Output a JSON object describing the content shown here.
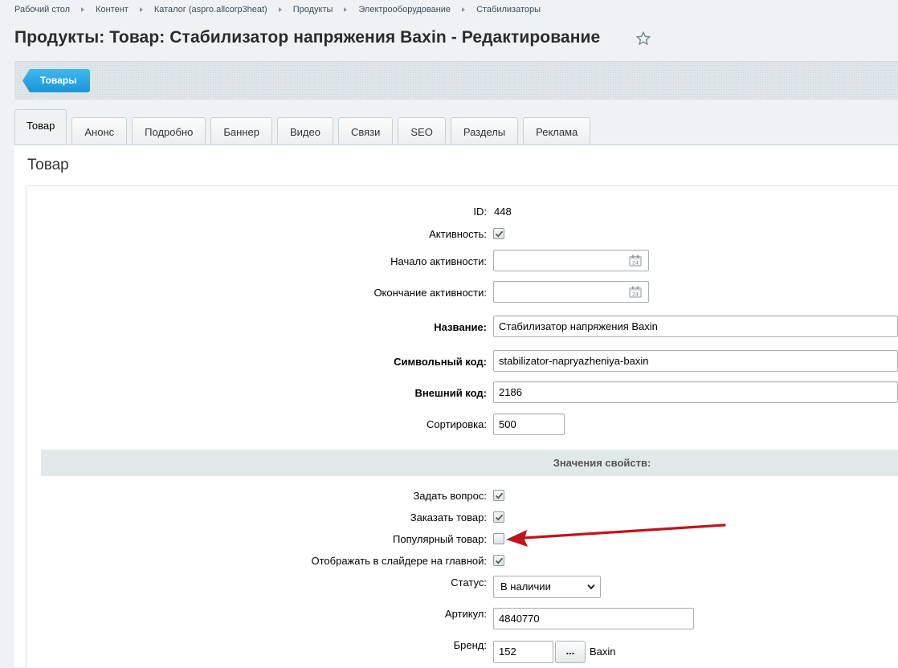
{
  "breadcrumb": [
    "Рабочий стол",
    "Контент",
    "Каталог (aspro.allcorp3heat)",
    "Продукты",
    "Электрооборудование",
    "Стабилизаторы"
  ],
  "title": "Продукты: Товар: Стабилизатор напряжения Baxin - Редактирование",
  "toolbar": {
    "back_label": "Товары"
  },
  "tabs": [
    "Товар",
    "Анонс",
    "Подробно",
    "Баннер",
    "Видео",
    "Связи",
    "SEO",
    "Разделы",
    "Реклама"
  ],
  "active_tab": "Товар",
  "panel_heading": "Товар",
  "form": {
    "id_label": "ID:",
    "id_value": "448",
    "active_label": "Активность:",
    "active_checked": true,
    "start_label": "Начало активности:",
    "end_label": "Окончание активности:",
    "name_label": "Название:",
    "name_value": "Стабилизатор напряжения Baxin",
    "code_label": "Символьный код:",
    "code_value": "stabilizator-napryazheniya-baxin",
    "ext_label": "Внешний код:",
    "ext_value": "2186",
    "sort_label": "Сортировка:",
    "sort_value": "500"
  },
  "properties": {
    "header": "Значения свойств:",
    "ask_label": "Задать вопрос:",
    "ask_checked": true,
    "order_label": "Заказать товар:",
    "order_checked": true,
    "popular_label": "Популярный товар:",
    "popular_checked": false,
    "slider_label": "Отображать в слайдере на главной:",
    "slider_checked": true,
    "status_label": "Статус:",
    "status_value": "В наличии",
    "article_label": "Артикул:",
    "article_value": "4840770",
    "brand_label": "Бренд:",
    "brand_value": "152",
    "brand_button": "...",
    "brand_name": "Baxin"
  },
  "colors": {
    "accent": "#1a96d6",
    "annotation_arrow": "#c0141c"
  }
}
